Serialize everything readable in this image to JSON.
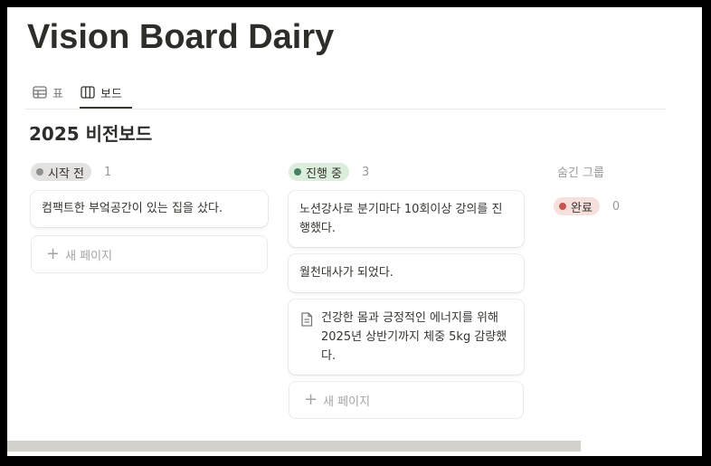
{
  "page": {
    "title": "Vision Board Dairy"
  },
  "tabs": [
    {
      "label": "표",
      "icon": "table-icon"
    },
    {
      "label": "보드",
      "icon": "board-icon",
      "active": true
    }
  ],
  "board": {
    "title": "2025 비전보드"
  },
  "columns": [
    {
      "label": "시작 전",
      "count": "1",
      "dot_color": "#91918e",
      "pill_bg": "#e3e2e0",
      "cards": [
        {
          "text": "컴팩트한 부엌공간이 있는 집을 샀다."
        }
      ],
      "new_page_label": "새 페이지"
    },
    {
      "label": "진행 중",
      "count": "3",
      "dot_color": "#448361",
      "pill_bg": "#dbeddb",
      "cards": [
        {
          "text": "노션강사로 분기마다 10회이상 강의를 진행했다."
        },
        {
          "text": "월천대사가 되었다."
        },
        {
          "text": "건강한 몸과 긍정적인 에너지를 위해 2025년 상반기까지 체중 5kg 감량했다.",
          "icon": "document-icon"
        }
      ],
      "new_page_label": "새 페이지"
    }
  ],
  "hidden_groups": {
    "label": "숨긴 그룹",
    "items": [
      {
        "label": "완료",
        "count": "0",
        "dot_color": "#c4554d",
        "pill_bg": "#f5e0dd"
      }
    ]
  }
}
